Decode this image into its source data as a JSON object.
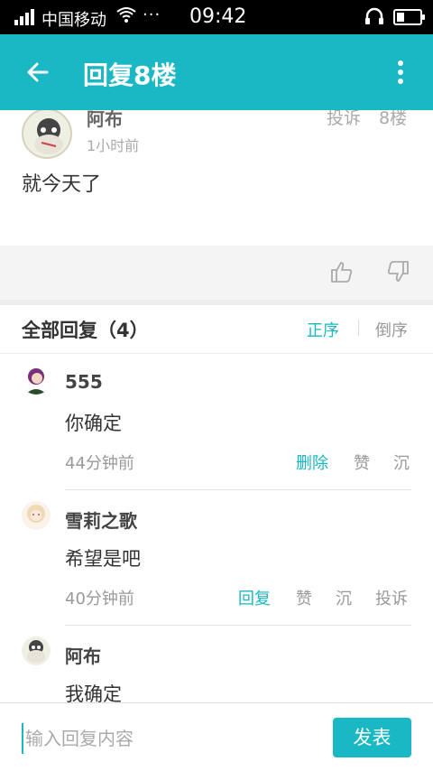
{
  "status_bar": {
    "carrier": "中国移动",
    "dots": "···",
    "time": "09:42"
  },
  "app_bar": {
    "title": "回复8楼"
  },
  "post": {
    "author": "阿布",
    "time": "1小时前",
    "report": "投诉",
    "floor": "8楼",
    "content": "就今天了"
  },
  "replies_header": {
    "title": "全部回复（4）",
    "sort_asc": "正序",
    "sort_desc": "倒序"
  },
  "replies": [
    {
      "name": "555",
      "text": "你确定",
      "time": "44分钟前",
      "actions": [
        "删除",
        "赞",
        "沉"
      ]
    },
    {
      "name": "雪莉之歌",
      "text": "希望是吧",
      "time": "40分钟前",
      "actions": [
        "回复",
        "赞",
        "沉",
        "投诉"
      ]
    },
    {
      "name": "阿布",
      "text": "我确定",
      "time": "",
      "actions": []
    }
  ],
  "input_bar": {
    "placeholder": "输入回复内容",
    "send": "发表"
  },
  "colors": {
    "accent": "#1ab7c4",
    "status_bar": "#000000"
  },
  "icons": [
    "signal-icon",
    "wifi-icon",
    "headphone-icon",
    "battery-icon",
    "back-arrow-icon",
    "more-vert-icon",
    "thumb-up-icon",
    "thumb-down-icon"
  ]
}
